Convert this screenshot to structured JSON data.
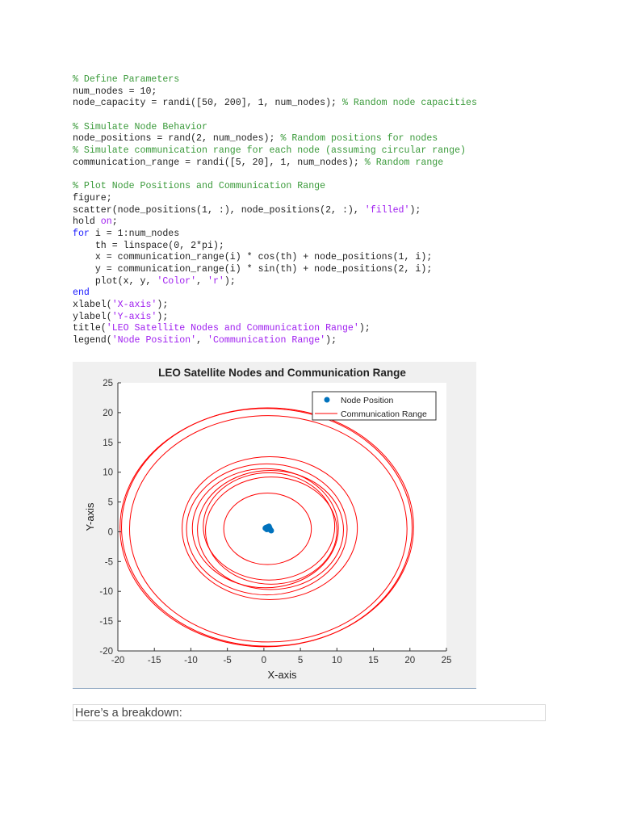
{
  "code_lines": [
    [
      {
        "t": "% Define Parameters",
        "c": "c"
      }
    ],
    [
      {
        "t": "num_nodes = 10;"
      }
    ],
    [
      {
        "t": "node_capacity = randi([50, 200], 1, num_nodes); "
      },
      {
        "t": "% Random node capacities",
        "c": "c"
      }
    ],
    [],
    [
      {
        "t": "% Simulate Node Behavior",
        "c": "c"
      }
    ],
    [
      {
        "t": "node_positions = rand(2, num_nodes); "
      },
      {
        "t": "% Random positions for nodes",
        "c": "c"
      }
    ],
    [
      {
        "t": "% Simulate communication range for each node (assuming circular range)",
        "c": "c"
      }
    ],
    [
      {
        "t": "communication_range = randi([5, 20], 1, num_nodes); "
      },
      {
        "t": "% Random range",
        "c": "c"
      }
    ],
    [],
    [
      {
        "t": "% Plot Node Positions and Communication Range",
        "c": "c"
      }
    ],
    [
      {
        "t": "figure;"
      }
    ],
    [
      {
        "t": "scatter(node_positions(1, :), node_positions(2, :), "
      },
      {
        "t": "'filled'",
        "c": "s"
      },
      {
        "t": ");"
      }
    ],
    [
      {
        "t": "hold "
      },
      {
        "t": "on",
        "c": "s"
      },
      {
        "t": ";"
      }
    ],
    [
      {
        "t": "for",
        "c": "k"
      },
      {
        "t": " i = 1:num_nodes"
      }
    ],
    [
      {
        "t": "    th = linspace(0, 2*pi);"
      }
    ],
    [
      {
        "t": "    x = communication_range(i) * cos(th) + node_positions(1, i);"
      }
    ],
    [
      {
        "t": "    y = communication_range(i) * sin(th) + node_positions(2, i);"
      }
    ],
    [
      {
        "t": "    plot(x, y, "
      },
      {
        "t": "'Color'",
        "c": "s"
      },
      {
        "t": ", "
      },
      {
        "t": "'r'",
        "c": "s"
      },
      {
        "t": ");"
      }
    ],
    [
      {
        "t": "end",
        "c": "k"
      }
    ],
    [
      {
        "t": "xlabel("
      },
      {
        "t": "'X-axis'",
        "c": "s"
      },
      {
        "t": ");"
      }
    ],
    [
      {
        "t": "ylabel("
      },
      {
        "t": "'Y-axis'",
        "c": "s"
      },
      {
        "t": ");"
      }
    ],
    [
      {
        "t": "title("
      },
      {
        "t": "'LEO Satellite Nodes and Communication Range'",
        "c": "s"
      },
      {
        "t": ");"
      }
    ],
    [
      {
        "t": "legend("
      },
      {
        "t": "'Node Position'",
        "c": "s"
      },
      {
        "t": ", "
      },
      {
        "t": "'Communication Range'",
        "c": "s"
      },
      {
        "t": ");"
      }
    ]
  ],
  "chart_data": {
    "type": "scatter",
    "title": "LEO Satellite Nodes and Communication Range",
    "xlabel": "X-axis",
    "ylabel": "Y-axis",
    "xlim": [
      -20,
      25
    ],
    "ylim": [
      -20,
      25
    ],
    "xticks": [
      -20,
      -15,
      -10,
      -5,
      0,
      5,
      10,
      15,
      20,
      25
    ],
    "yticks": [
      -20,
      -15,
      -10,
      -5,
      0,
      5,
      10,
      15,
      20,
      25
    ],
    "legend": [
      "Node Position",
      "Communication Range"
    ],
    "legend_placement": "top-right",
    "nodes": [
      [
        0.3,
        0.7
      ],
      [
        0.5,
        0.8
      ],
      [
        0.6,
        0.5
      ],
      [
        0.8,
        0.6
      ],
      [
        0.4,
        0.4
      ],
      [
        0.9,
        0.3
      ],
      [
        0.2,
        0.6
      ],
      [
        0.7,
        0.9
      ],
      [
        1.0,
        0.2
      ],
      [
        0.5,
        0.5
      ]
    ],
    "ranges": [
      20,
      20,
      19,
      12,
      11,
      10,
      10,
      9,
      9,
      6
    ],
    "colors": {
      "node": "#0072bd",
      "circle": "#ff0000"
    }
  },
  "footer": {
    "breakdown": "Here’s a breakdown:"
  }
}
